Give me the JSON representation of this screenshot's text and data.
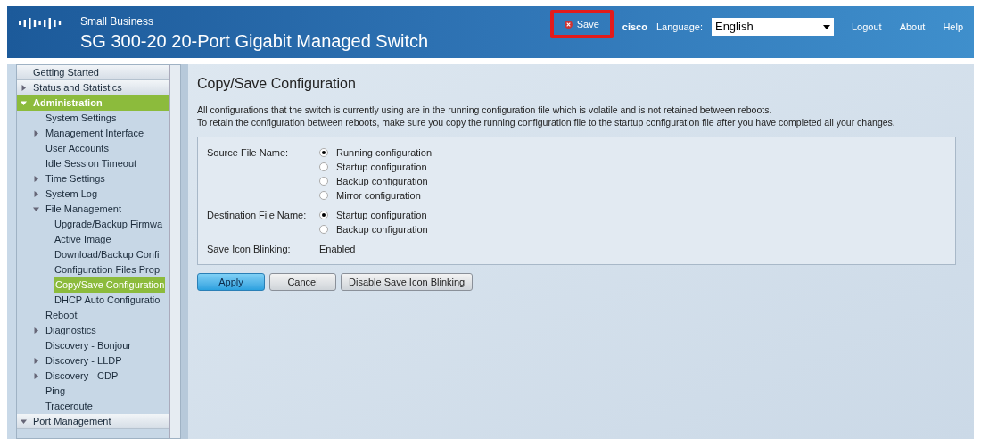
{
  "header": {
    "brand_line": "Small Business",
    "product": "SG 300-20 20-Port Gigabit Managed Switch",
    "save": {
      "label": "Save",
      "highlighted": true
    },
    "user": "cisco",
    "language_label": "Language:",
    "language": "English",
    "links": [
      "Logout",
      "About",
      "Help"
    ]
  },
  "sidebar": {
    "items": [
      {
        "label": "Getting Started",
        "kind": "page",
        "selected": false
      },
      {
        "label": "Status and Statistics",
        "kind": "folder",
        "expanded": false,
        "selected": false
      },
      {
        "label": "Administration",
        "kind": "folder",
        "expanded": true,
        "selected": true,
        "children": [
          {
            "label": "System Settings",
            "kind": "page",
            "selected": false
          },
          {
            "label": "Management Interface",
            "kind": "folder",
            "expanded": false,
            "selected": false
          },
          {
            "label": "User Accounts",
            "kind": "page",
            "selected": false
          },
          {
            "label": "Idle Session Timeout",
            "kind": "page",
            "selected": false
          },
          {
            "label": "Time Settings",
            "kind": "folder",
            "expanded": false,
            "selected": false
          },
          {
            "label": "System Log",
            "kind": "folder",
            "expanded": false,
            "selected": false
          },
          {
            "label": "File Management",
            "kind": "folder",
            "expanded": true,
            "selected": false,
            "children": [
              {
                "label": "Upgrade/Backup Firmwa",
                "kind": "page",
                "selected": false
              },
              {
                "label": "Active Image",
                "kind": "page",
                "selected": false
              },
              {
                "label": "Download/Backup Confi",
                "kind": "page",
                "selected": false
              },
              {
                "label": "Configuration Files Prop",
                "kind": "page",
                "selected": false
              },
              {
                "label": "Copy/Save Configuration",
                "kind": "page",
                "selected": true
              },
              {
                "label": "DHCP Auto Configuratio",
                "kind": "page",
                "selected": false
              }
            ]
          },
          {
            "label": "Reboot",
            "kind": "page",
            "selected": false
          },
          {
            "label": "Diagnostics",
            "kind": "folder",
            "expanded": false,
            "selected": false
          },
          {
            "label": "Discovery - Bonjour",
            "kind": "page",
            "selected": false
          },
          {
            "label": "Discovery - LLDP",
            "kind": "folder",
            "expanded": false,
            "selected": false
          },
          {
            "label": "Discovery - CDP",
            "kind": "folder",
            "expanded": false,
            "selected": false
          },
          {
            "label": "Ping",
            "kind": "page",
            "selected": false
          },
          {
            "label": "Traceroute",
            "kind": "page",
            "selected": false
          }
        ]
      },
      {
        "label": "Port Management",
        "kind": "folder",
        "expanded": true,
        "selected": false
      }
    ]
  },
  "content": {
    "title": "Copy/Save Configuration",
    "intro": [
      "All configurations that the switch is currently using are in the running configuration file which is volatile and is not retained between reboots.",
      "To retain the configuration between reboots, make sure you copy the running configuration file to the startup configuration file after you have completed all your changes."
    ],
    "form": [
      {
        "kind": "radio",
        "label": "Source File Name:",
        "options": [
          {
            "label": "Running configuration",
            "selected": true
          },
          {
            "label": "Startup configuration",
            "selected": false
          },
          {
            "label": "Backup configuration",
            "selected": false
          },
          {
            "label": "Mirror configuration",
            "selected": false
          }
        ]
      },
      {
        "kind": "radio",
        "label": "Destination File Name:",
        "options": [
          {
            "label": "Startup configuration",
            "selected": true
          },
          {
            "label": "Backup configuration",
            "selected": false
          }
        ]
      },
      {
        "kind": "text",
        "label": "Save Icon Blinking:",
        "value": "Enabled"
      }
    ],
    "buttons": [
      {
        "label": "Apply",
        "primary": true
      },
      {
        "label": "Cancel",
        "primary": false
      },
      {
        "label": "Disable Save Icon Blinking",
        "primary": false
      }
    ]
  }
}
